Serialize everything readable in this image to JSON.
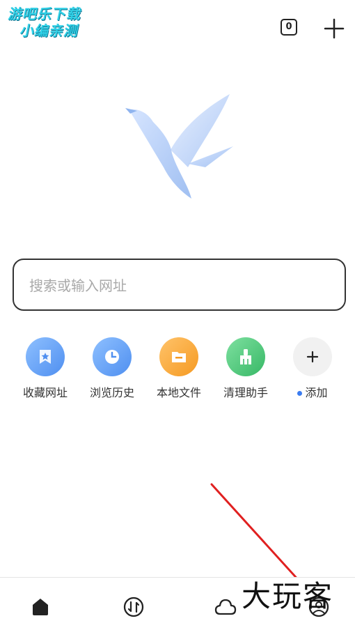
{
  "watermark": {
    "line1": "游吧乐下载",
    "line2": "小编亲测",
    "corner": "大玩客"
  },
  "header": {
    "tab_count": "0",
    "new_tab_icon": "plus-icon"
  },
  "logo": {
    "icon": "bird-logo-icon"
  },
  "search": {
    "placeholder": "搜索或输入网址"
  },
  "shortcuts": [
    {
      "label": "收藏网址",
      "icon": "bookmark-star-icon",
      "color": "#6aa6f2"
    },
    {
      "label": "浏览历史",
      "icon": "clock-icon",
      "color": "#5b9cf0"
    },
    {
      "label": "本地文件",
      "icon": "folder-icon",
      "color": "#f7a93b"
    },
    {
      "label": "清理助手",
      "icon": "broom-icon",
      "color": "#4cc77a"
    },
    {
      "label": "添加",
      "icon": "plus-icon",
      "color": "#f1f1f1"
    }
  ],
  "bottom_nav": [
    {
      "name": "home-icon"
    },
    {
      "name": "transfer-icon"
    },
    {
      "name": "cloud-icon"
    },
    {
      "name": "profile-icon"
    }
  ]
}
